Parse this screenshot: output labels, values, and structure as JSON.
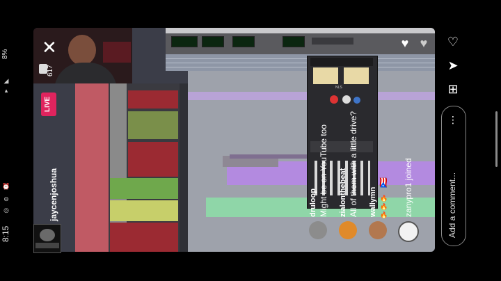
{
  "status_bar": {
    "time": "8:15",
    "battery": "8%",
    "icons": [
      "wifi-icon",
      "signal-icon",
      "lte-icon",
      "alarm-icon",
      "dnd-icon",
      "instagram-icon"
    ]
  },
  "live": {
    "viewer_count": "617",
    "badge": "LIVE",
    "host": "jaycenjoshua"
  },
  "plugin": {
    "name": "NLS"
  },
  "comments": [
    {
      "user": "druloop",
      "text": "Might be on YouTube too"
    },
    {
      "user": "zialonthebeat",
      "text": "All of them with a little drive?"
    },
    {
      "user": "wallymn",
      "text": "🇵🇷"
    },
    {
      "user": "",
      "text": "zanypro1 joined"
    }
  ],
  "composer": {
    "placeholder": "Add a comment..."
  },
  "colors": {
    "live_badge": "#e0245e",
    "clip_purple": "#b38ae0",
    "clip_green": "#8fd6a8",
    "clip_yellow": "#e6e29a",
    "mixer_red": "#9b2a32",
    "mixer_green": "#6fa84c"
  }
}
